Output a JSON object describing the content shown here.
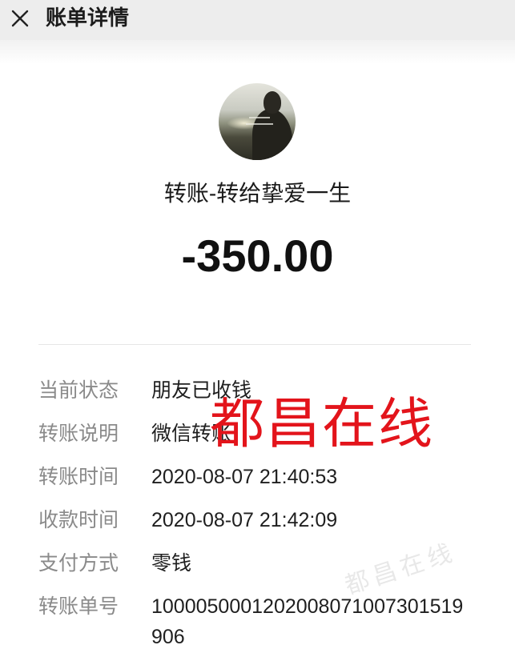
{
  "header": {
    "title": "账单详情",
    "close_icon": "close-icon"
  },
  "transfer": {
    "avatar_icon": "avatar-photo",
    "title": "转账-转给挚爱一生",
    "amount": "-350.00"
  },
  "details": [
    {
      "label": "当前状态",
      "value": "朋友已收钱"
    },
    {
      "label": "转账说明",
      "value": "微信转账"
    },
    {
      "label": "转账时间",
      "value": "2020-08-07 21:40:53"
    },
    {
      "label": "收款时间",
      "value": "2020-08-07 21:42:09"
    },
    {
      "label": "支付方式",
      "value": "零钱"
    },
    {
      "label": "转账单号",
      "value": "1000050001202008071007301519906"
    }
  ],
  "watermark": {
    "text": "都昌在线",
    "color": "#e3141b"
  },
  "faint_watermark": {
    "text": "都昌在线"
  },
  "colors": {
    "header_bg": "#ededed",
    "label": "#8a8a8a",
    "value": "#1f1f1f",
    "divider": "#e6e6e6"
  }
}
